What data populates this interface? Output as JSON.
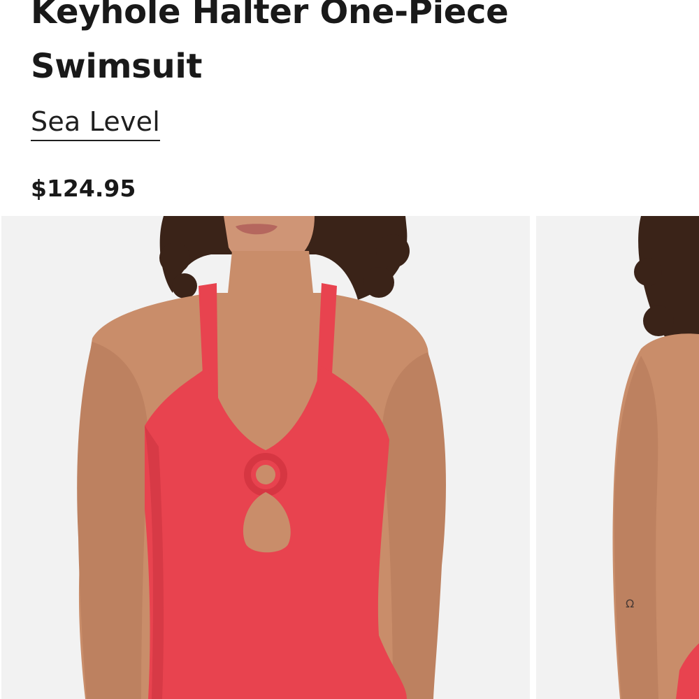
{
  "product": {
    "title": "Keyhole Halter One-Piece Swimsuit",
    "brand": "Sea Level",
    "price": "$124.95"
  },
  "gallery": {
    "images": [
      {
        "subject": "model wearing red keyhole halter one-piece swimsuit, front view"
      },
      {
        "subject": "model wearing red keyhole halter one-piece swimsuit, back view"
      }
    ]
  },
  "colors": {
    "swimsuit": "#e8434f",
    "skin": "#c98d6a",
    "hair": "#3a2318",
    "background": "#f2f2f2",
    "text": "#191919"
  }
}
